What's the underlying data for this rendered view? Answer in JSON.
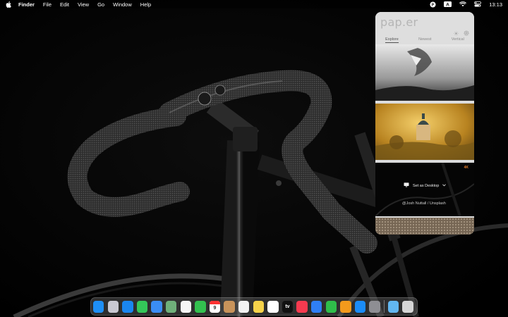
{
  "menubar": {
    "app_name": "Finder",
    "items": [
      "File",
      "Edit",
      "View",
      "Go",
      "Window",
      "Help"
    ],
    "time": "13:13",
    "icons": [
      "apple-icon",
      "paper-app-icon",
      "input-source-icon",
      "wifi-icon",
      "control-center-icon"
    ]
  },
  "paper_panel": {
    "logo": "pap.er",
    "tabs": [
      "Explore",
      "Newest",
      "Vertical"
    ],
    "active_tab": "Explore",
    "hover_card": {
      "badge": "4K",
      "set_desktop_label": "Set as Desktop",
      "credit": "@Josh Nuttall / Unsplash"
    }
  },
  "dock": {
    "apps": [
      {
        "name": "finder-icon",
        "color": "#1e8ff5"
      },
      {
        "name": "launchpad-icon",
        "color": "#c9c9d2"
      },
      {
        "name": "safari-icon",
        "color": "#1a86f0"
      },
      {
        "name": "messages-icon",
        "color": "#34c759"
      },
      {
        "name": "mail-icon",
        "color": "#3a8df5"
      },
      {
        "name": "maps-icon",
        "color": "#6fb07a"
      },
      {
        "name": "photos-icon",
        "color": "#f5f5f5"
      },
      {
        "name": "facetime-icon",
        "color": "#33c14f"
      },
      {
        "name": "calendar-icon",
        "color": "#ffffff",
        "text": "9"
      },
      {
        "name": "contacts-icon",
        "color": "#c8935a"
      },
      {
        "name": "reminders-icon",
        "color": "#f2f2f2"
      },
      {
        "name": "notes-icon",
        "color": "#f6d34a"
      },
      {
        "name": "freeform-icon",
        "color": "#ffffff"
      },
      {
        "name": "apple-tv-icon",
        "color": "#111111",
        "text": "tv"
      },
      {
        "name": "music-icon",
        "color": "#f83a4f"
      },
      {
        "name": "keynote-icon",
        "color": "#2f7ff5"
      },
      {
        "name": "numbers-icon",
        "color": "#2fbe4a"
      },
      {
        "name": "pages-icon",
        "color": "#f39a1c"
      },
      {
        "name": "app-store-icon",
        "color": "#1b8cf7"
      },
      {
        "name": "system-settings-icon",
        "color": "#8e8e93"
      }
    ],
    "trailing": [
      {
        "name": "downloads-folder-icon",
        "color": "#62b7f0"
      },
      {
        "name": "trash-icon",
        "color": "#d6d6d6"
      }
    ]
  }
}
